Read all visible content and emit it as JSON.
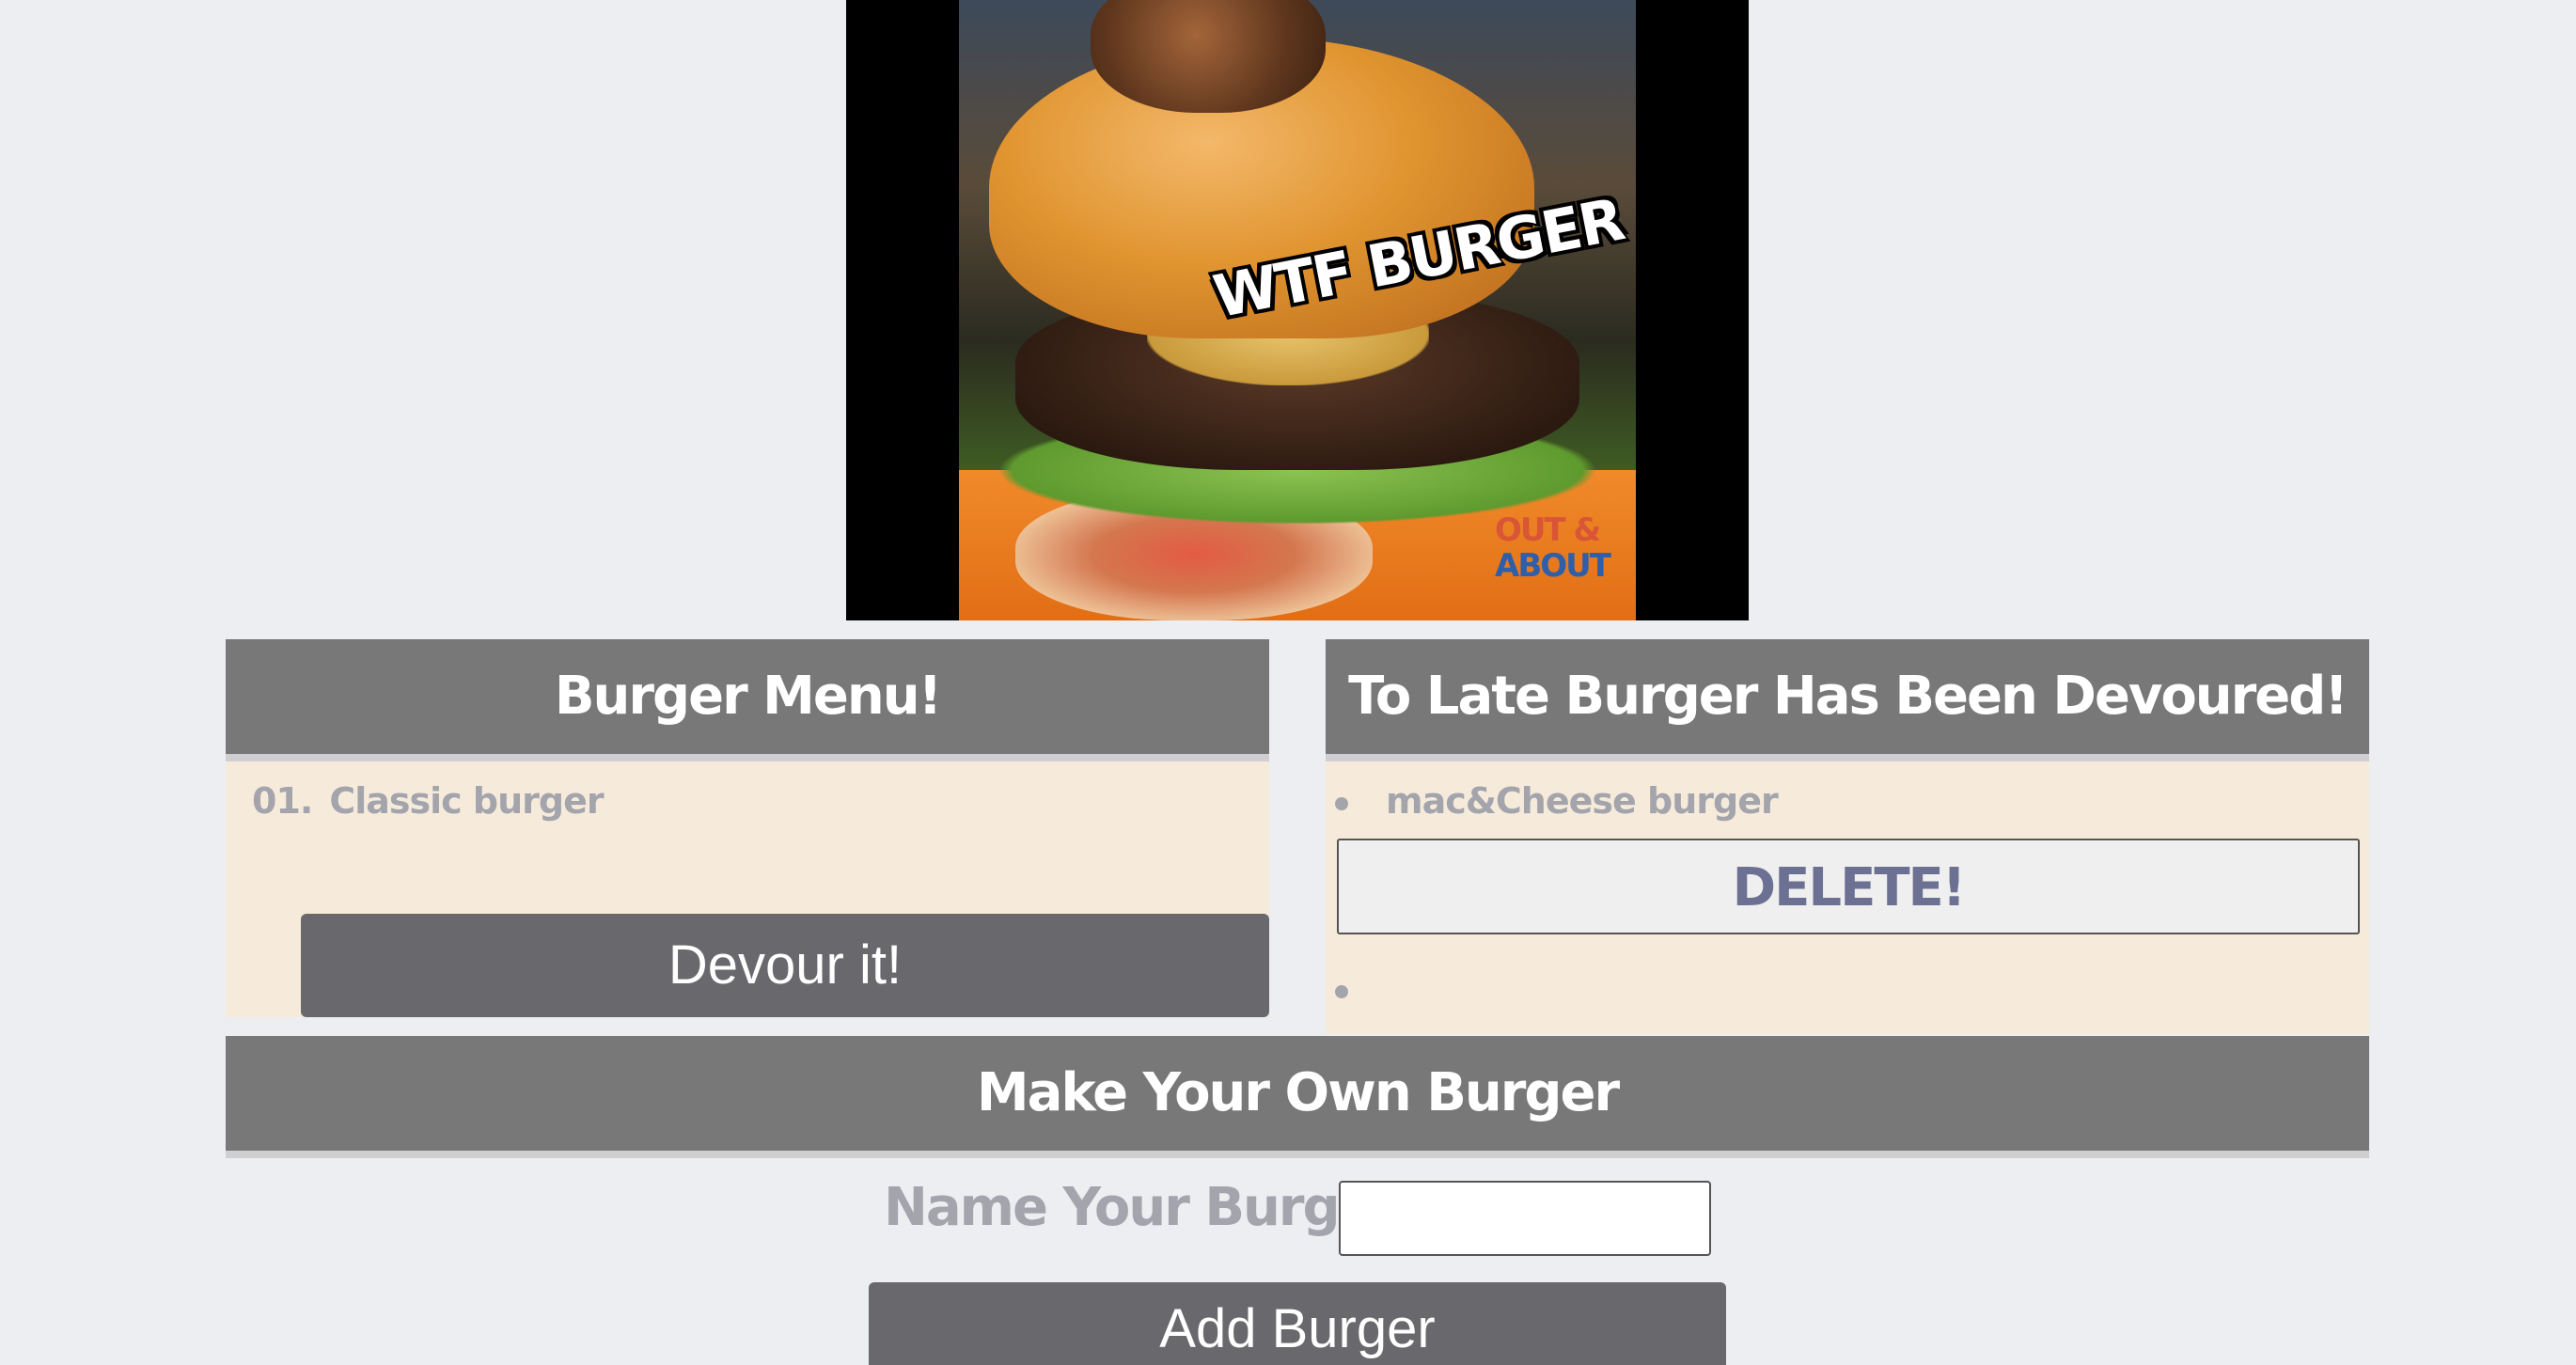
{
  "hero": {
    "label": "WTF BURGER",
    "watermark_line1": "OUT &",
    "watermark_line2": "ABOUT"
  },
  "menu_panel": {
    "title": "Burger Menu!",
    "items": [
      {
        "number": "01.",
        "name": "Classic burger"
      }
    ],
    "devour_button_label": "Devour it!"
  },
  "devoured_panel": {
    "title": "To Late Burger Has Been Devoured!",
    "items": [
      {
        "name": "mac&Cheese burger",
        "delete_button_label": "DELETE!"
      }
    ]
  },
  "make_panel": {
    "title": "Make Your Own Burger",
    "name_label": "Name Your Burger:",
    "name_value": "",
    "add_button_label": "Add Burger"
  },
  "colors": {
    "header_bg": "#787879",
    "panel_bg": "#f6ebdb",
    "button_bg": "#69696d",
    "page_bg": "#eceef2",
    "muted_text": "#a4a5ac",
    "delete_text": "#6c7193"
  }
}
